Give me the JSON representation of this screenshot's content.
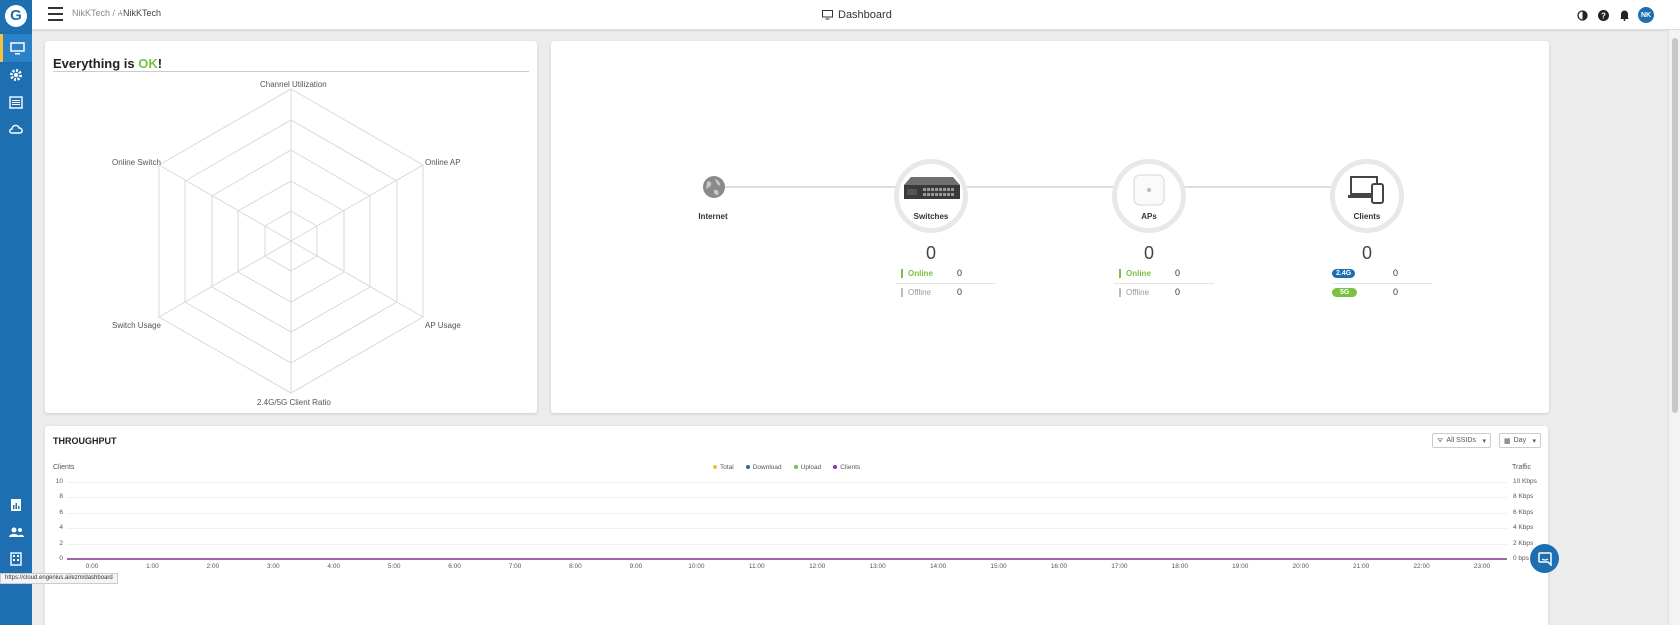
{
  "topbar": {
    "breadcrumb_org": "NikKTech",
    "breadcrumb_sep": "/",
    "breadcrumb_net": "NikKTech",
    "title": "Dashboard",
    "avatar_initials": "NK"
  },
  "health": {
    "title_prefix": "Everything is ",
    "title_ok": "OK",
    "title_suffix": "!",
    "axes": [
      "Channel Utilization",
      "Online AP",
      "AP Usage",
      "2.4G/5G Client Ratio",
      "Switch Usage",
      "Online Switch"
    ]
  },
  "topology": {
    "internet_label": "Internet",
    "switches": {
      "label": "Switches",
      "count": "0",
      "online_label": "Online",
      "online": "0",
      "offline_label": "Offline",
      "offline": "0"
    },
    "aps": {
      "label": "APs",
      "count": "0",
      "online_label": "Online",
      "online": "0",
      "offline_label": "Offline",
      "offline": "0"
    },
    "clients": {
      "label": "Clients",
      "count": "0",
      "band1_label": "2.4G",
      "band1": "0",
      "band2_label": "5G",
      "band2": "0"
    }
  },
  "throughput": {
    "title": "THROUGHPUT",
    "ssid_filter": "All SSIDs",
    "range_filter": "Day",
    "legend": [
      "Total",
      "Download",
      "Upload",
      "Clients"
    ],
    "left_axis_title": "Clients",
    "right_axis_title": "Traffic",
    "left_ticks": [
      "10",
      "8",
      "6",
      "4",
      "2",
      "0"
    ],
    "right_ticks": [
      "10 Kbps",
      "8 Kbps",
      "6 Kbps",
      "4 Kbps",
      "2 Kbps",
      "0 bps"
    ],
    "x_ticks": [
      "0:00",
      "1:00",
      "2:00",
      "3:00",
      "4:00",
      "5:00",
      "6:00",
      "7:00",
      "8:00",
      "9:00",
      "10:00",
      "11:00",
      "12:00",
      "13:00",
      "14:00",
      "15:00",
      "16:00",
      "17:00",
      "18:00",
      "19:00",
      "20:00",
      "21:00",
      "22:00",
      "23:00"
    ]
  },
  "status_url": "https://cloud.engenius.ai/ezm/dashboard",
  "colors": {
    "primary": "#1e6fb2",
    "ok_green": "#7ac142",
    "sidebar_accent": "#f6c23e",
    "total": "#f6b93b",
    "download": "#1e6fb2",
    "upload": "#7ac142",
    "clients": "#9b27b0"
  },
  "chart_data": {
    "type": "line",
    "x": [
      "0:00",
      "1:00",
      "2:00",
      "3:00",
      "4:00",
      "5:00",
      "6:00",
      "7:00",
      "8:00",
      "9:00",
      "10:00",
      "11:00",
      "12:00",
      "13:00",
      "14:00",
      "15:00",
      "16:00",
      "17:00",
      "18:00",
      "19:00",
      "20:00",
      "21:00",
      "22:00",
      "23:00"
    ],
    "series": [
      {
        "name": "Total",
        "values": [
          0,
          0,
          0,
          0,
          0,
          0,
          0,
          0,
          0,
          0,
          0,
          0,
          0,
          0,
          0,
          0,
          0,
          0,
          0,
          0,
          0,
          0,
          0,
          0
        ]
      },
      {
        "name": "Download",
        "values": [
          0,
          0,
          0,
          0,
          0,
          0,
          0,
          0,
          0,
          0,
          0,
          0,
          0,
          0,
          0,
          0,
          0,
          0,
          0,
          0,
          0,
          0,
          0,
          0
        ]
      },
      {
        "name": "Upload",
        "values": [
          0,
          0,
          0,
          0,
          0,
          0,
          0,
          0,
          0,
          0,
          0,
          0,
          0,
          0,
          0,
          0,
          0,
          0,
          0,
          0,
          0,
          0,
          0,
          0
        ]
      },
      {
        "name": "Clients",
        "values": [
          0,
          0,
          0,
          0,
          0,
          0,
          0,
          0,
          0,
          0,
          0,
          0,
          0,
          0,
          0,
          0,
          0,
          0,
          0,
          0,
          0,
          0,
          0,
          0
        ]
      }
    ],
    "title": "THROUGHPUT",
    "ylabel": "Clients",
    "y2label": "Traffic",
    "ylim": [
      0,
      10
    ],
    "y2lim": [
      0,
      10
    ],
    "legend": "top-center"
  }
}
